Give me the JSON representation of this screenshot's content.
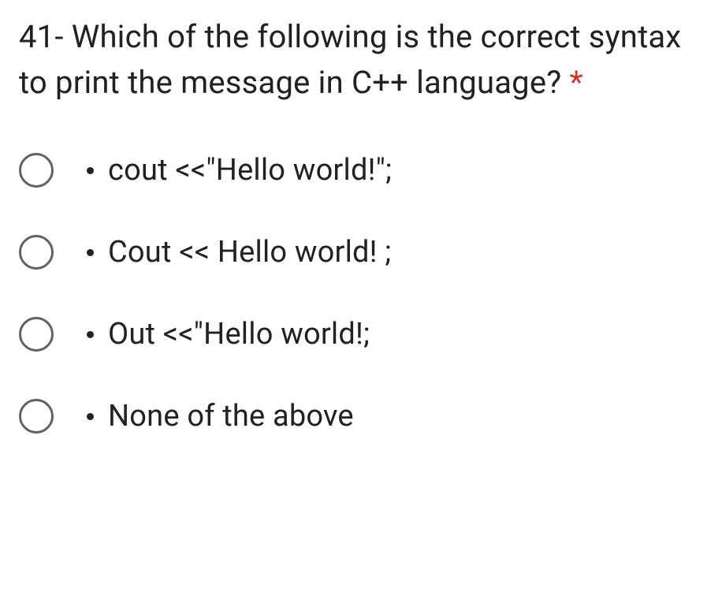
{
  "question": {
    "number": "41-",
    "text": "Which of the following is the correct syntax to print the message in C++ language?",
    "required_marker": "*"
  },
  "options": [
    {
      "label": "cout <<\"Hello world!\";"
    },
    {
      "label": "Cout << Hello world! ;"
    },
    {
      "label": "Out <<\"Hello world!;"
    },
    {
      "label": "None of the above"
    }
  ]
}
